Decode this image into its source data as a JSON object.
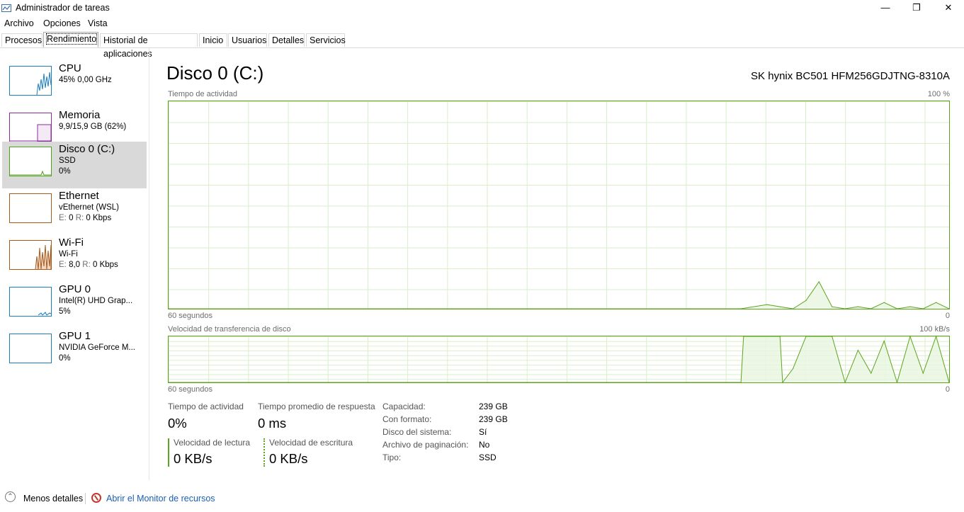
{
  "window": {
    "title": "Administrador de tareas",
    "minimize": "—",
    "maximize": "❐",
    "close": "✕"
  },
  "menu": [
    "Archivo",
    "Opciones",
    "Vista"
  ],
  "tabs": [
    "Procesos",
    "Rendimiento",
    "Historial de aplicaciones",
    "Inicio",
    "Usuarios",
    "Detalles",
    "Servicios"
  ],
  "active_tab": "Rendimiento",
  "sidebar": {
    "items": [
      {
        "name": "CPU",
        "line1": "45% 0,00 GHz",
        "line2": "",
        "color": "#1a7dbd"
      },
      {
        "name": "Memoria",
        "line1": "9,9/15,9 GB (62%)",
        "line2": "",
        "color": "#8b2d9c"
      },
      {
        "name": "Disco 0 (C:)",
        "line1": "SSD",
        "line2": "0%",
        "color": "#4da01a"
      },
      {
        "name": "Ethernet",
        "line1": "vEthernet (WSL)",
        "line2_send_label": "E:",
        "line2_send": "0",
        "line2_recv_label": "R:",
        "line2_recv": "0 Kbps",
        "color": "#a8591a"
      },
      {
        "name": "Wi-Fi",
        "line1": "Wi-Fi",
        "line2_send_label": "E:",
        "line2_send": "8,0",
        "line2_recv_label": "R:",
        "line2_recv": "0 Kbps",
        "color": "#a8591a"
      },
      {
        "name": "GPU 0",
        "line1": "Intel(R) UHD Grap...",
        "line2": "5%",
        "color": "#1a7dbd"
      },
      {
        "name": "GPU 1",
        "line1": "NVIDIA GeForce M...",
        "line2": "0%",
        "color": "#1a7dbd"
      }
    ]
  },
  "main": {
    "title": "Disco 0 (C:)",
    "model": "SK hynix BC501 HFM256GDJTNG-8310A",
    "graph1": {
      "label": "Tiempo de actividad",
      "max": "100 %",
      "time": "60 segundos",
      "min": "0"
    },
    "graph2": {
      "label": "Velocidad de transferencia de disco",
      "max": "100 kB/s",
      "time": "60 segundos",
      "min": "0"
    },
    "stats": {
      "active_label": "Tiempo de actividad",
      "active_value": "0%",
      "resp_label": "Tiempo promedio de respuesta",
      "resp_value": "0 ms",
      "read_label": "Velocidad de lectura",
      "read_value": "0 KB/s",
      "write_label": "Velocidad de escritura",
      "write_value": "0 KB/s"
    },
    "properties": [
      {
        "label": "Capacidad:",
        "value": "239 GB"
      },
      {
        "label": "Con formato:",
        "value": "239 GB"
      },
      {
        "label": "Disco del sistema:",
        "value": "Sí"
      },
      {
        "label": "Archivo de paginación:",
        "value": "No"
      },
      {
        "label": "Tipo:",
        "value": "SSD"
      }
    ]
  },
  "footer": {
    "fewer_details": "Menos detalles",
    "resource_monitor": "Abrir el Monitor de recursos"
  },
  "chart_data": [
    {
      "type": "area",
      "title": "Tiempo de actividad",
      "xlabel": "60 segundos",
      "ylim": [
        0,
        100
      ],
      "x": [
        0,
        10,
        20,
        30,
        40,
        44,
        46,
        47,
        48,
        49,
        50,
        51,
        52,
        53,
        54,
        55,
        56,
        57,
        58,
        59,
        60
      ],
      "values": [
        0,
        0,
        0,
        0,
        0,
        0,
        2,
        1,
        0,
        4,
        13,
        1,
        0,
        1,
        0,
        3,
        0,
        1,
        0,
        3,
        0
      ]
    },
    {
      "type": "area",
      "title": "Velocidad de transferencia de disco",
      "xlabel": "60 segundos",
      "ylim": [
        0,
        100
      ],
      "x": [
        0,
        10,
        20,
        30,
        40,
        44,
        44.2,
        47,
        47.2,
        48,
        49,
        51,
        52,
        53,
        54,
        55,
        56,
        57,
        58,
        59,
        60
      ],
      "values": [
        0,
        0,
        0,
        0,
        0,
        0,
        100,
        100,
        0,
        30,
        100,
        100,
        0,
        70,
        20,
        90,
        0,
        100,
        20,
        100,
        0
      ]
    }
  ]
}
